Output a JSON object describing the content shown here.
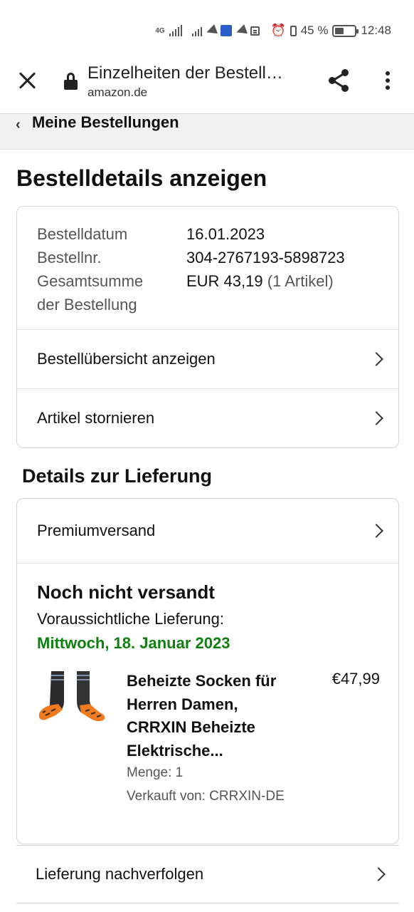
{
  "status_bar": {
    "network": "4G",
    "battery": "45 %",
    "battery_level": 0.45,
    "time": "12:48"
  },
  "browser": {
    "tab_title": "Einzelheiten der Bestell…",
    "domain": "amazon.de"
  },
  "breadcrumb": {
    "label": "Meine Bestellungen"
  },
  "page": {
    "heading": "Bestelldetails anzeigen"
  },
  "order_info": {
    "date_label": "Bestelldatum",
    "date_value": "16.01.2023",
    "number_label": "Bestellnr.",
    "number_value": "304-2767193-5898723",
    "total_label_line1": "Gesamtsumme",
    "total_label_line2": "der Bestellung",
    "total_value": "EUR 43,19",
    "total_items": "(1 Artikel)"
  },
  "order_actions": {
    "overview": "Bestellübersicht anzeigen",
    "cancel": "Artikel stornieren"
  },
  "delivery": {
    "section_heading": "Details zur Lieferung",
    "shipping_method": "Premiumversand",
    "status": "Noch nicht versandt",
    "expected_label": "Voraussichtliche Lieferung:",
    "expected_date": "Mittwoch, 18. Januar 2023",
    "track": "Lieferung nachverfolgen"
  },
  "product": {
    "title_line1": "Beheizte Socken für",
    "title_line2": "Herren Damen,",
    "title_line3": "CRRXIN Beheizte",
    "title_line4": "Elektrische...",
    "price": "€47,99",
    "quantity": "Menge: 1",
    "seller": "Verkauft von: CRRXIN-DE"
  },
  "colors": {
    "delivery_date": "#0f7f0f",
    "breadcrumb_bg": "#f1f1f1"
  }
}
